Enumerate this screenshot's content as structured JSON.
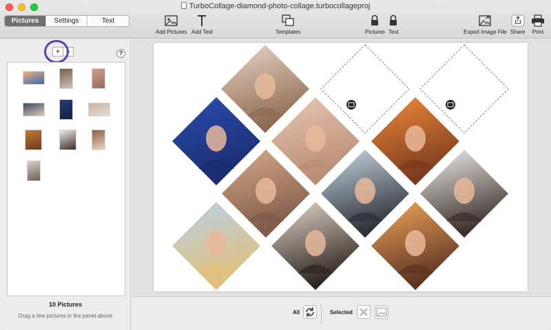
{
  "window": {
    "title": "TurboCollage-diamond-photo-collage.turbocollageproj"
  },
  "tabs": [
    {
      "label": "Pictures",
      "active": true
    },
    {
      "label": "Settings",
      "active": false
    },
    {
      "label": "Text",
      "active": false
    }
  ],
  "toolbar": {
    "add_pictures": "Add Pictures",
    "add_text": "Add Text",
    "templates": "Templates",
    "lock_pictures": "Pictures",
    "lock_text": "Text",
    "export": "Export Image File",
    "share": "Share",
    "print": "Print"
  },
  "panel": {
    "add_label": "+",
    "remove_label": "−",
    "help_label": "?",
    "count": "10 Pictures",
    "hint": "Drag a few pictures in the panel above"
  },
  "bottom": {
    "all_label": "All",
    "selected_label": "Selected"
  },
  "colors": {
    "accent_ring": "#5a3fb3",
    "active_tab": "#6f6f6f"
  },
  "thumbnails": [
    {
      "c1": "#e9b27c",
      "c2": "#3a68b4"
    },
    {
      "c1": "#7a5f4a",
      "c2": "#c9c2b8"
    },
    {
      "c1": "#caa08b",
      "c2": "#9d6a5a"
    },
    {
      "c1": "#3d4b61",
      "c2": "#d8c8b9"
    },
    {
      "c1": "#233a7a",
      "c2": "#17223d"
    },
    {
      "c1": "#c7b2a2",
      "c2": "#e7dcd4"
    },
    {
      "c1": "#c67b2e",
      "c2": "#6b3a22"
    },
    {
      "c1": "#efe9e3",
      "c2": "#3b2f29"
    },
    {
      "c1": "#8a5d43",
      "c2": "#e8d6c4"
    },
    {
      "c1": "#d8d1c8",
      "c2": "#6f5f55"
    }
  ],
  "tiles": [
    {
      "c1": "#e9d6c4",
      "c2": "#8c6a52"
    },
    {
      "c1": "#2b4db0",
      "c2": "#1a2c6e"
    },
    {
      "c1": "#e6c9b4",
      "c2": "#b98b73"
    },
    {
      "c1": "#f08a3a",
      "c2": "#7a3a1e"
    },
    {
      "c1": "#d7ab8a",
      "c2": "#7e5a48"
    },
    {
      "c1": "#c9d8e6",
      "c2": "#2c2f36"
    },
    {
      "c1": "#f0f0ef",
      "c2": "#3c302a"
    },
    {
      "c1": "#b7d0e8",
      "c2": "#e2c07a"
    },
    {
      "c1": "#e4d8cc",
      "c2": "#2d2420"
    },
    {
      "c1": "#f2a65a",
      "c2": "#5b3322"
    }
  ]
}
